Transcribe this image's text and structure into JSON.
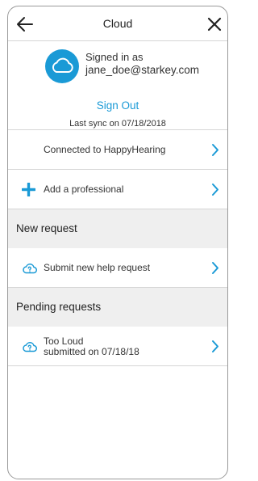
{
  "header": {
    "title": "Cloud",
    "back_icon": "back-arrow-icon",
    "close_icon": "close-icon"
  },
  "account": {
    "signed_in_label": "Signed in as",
    "email": "jane_doe@starkey.com",
    "sign_out_label": "Sign Out",
    "last_sync": "Last sync on 07/18/2018",
    "avatar_icon": "cloud-icon"
  },
  "connections": {
    "connected_label": "Connected to HappyHearing",
    "add_professional_label": "Add a professional"
  },
  "new_request": {
    "section_title": "New request",
    "submit_label": "Submit new help request"
  },
  "pending": {
    "section_title": "Pending requests",
    "items": [
      {
        "title": "Too Loud",
        "subtitle": "submitted on 07/18/18"
      }
    ]
  },
  "colors": {
    "accent": "#1a9ad6",
    "section_bg": "#efefef",
    "divider": "#d6d6d6"
  }
}
